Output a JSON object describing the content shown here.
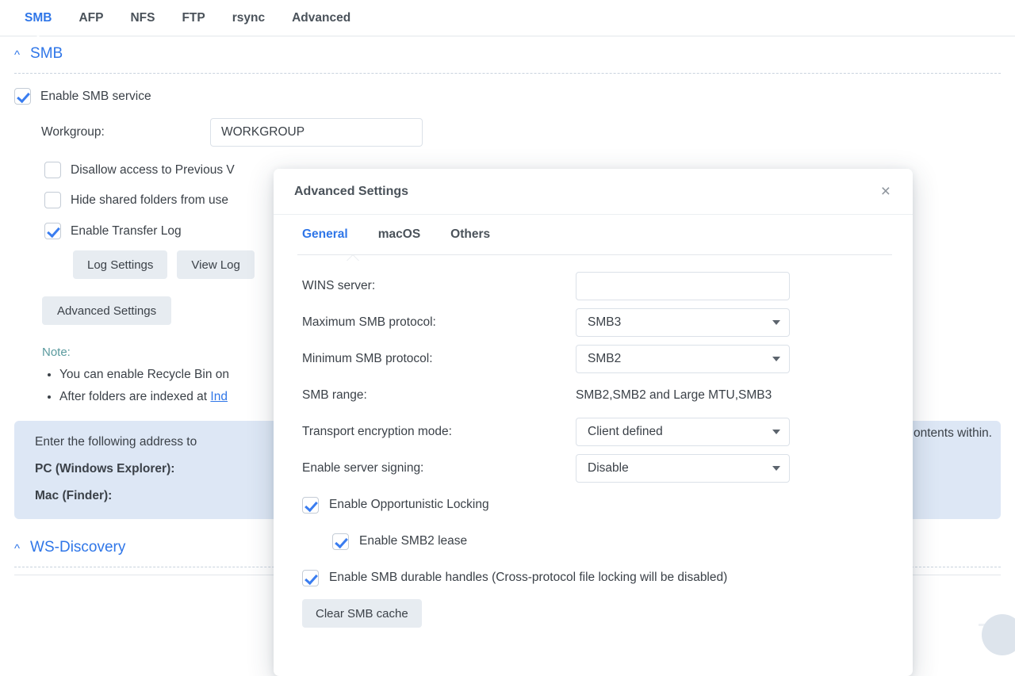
{
  "tabbar": {
    "tabs": [
      {
        "label": "SMB",
        "active": true
      },
      {
        "label": "AFP",
        "active": false
      },
      {
        "label": "NFS",
        "active": false
      },
      {
        "label": "FTP",
        "active": false
      },
      {
        "label": "rsync",
        "active": false
      },
      {
        "label": "Advanced",
        "active": false
      }
    ]
  },
  "smb_section": {
    "title": "SMB",
    "caret": "^",
    "enable_service": {
      "label": "Enable SMB service",
      "checked": true
    },
    "workgroup": {
      "label": "Workgroup:",
      "value": "WORKGROUP"
    },
    "disallow_previous": {
      "label": "Disallow access to Previous V",
      "checked": false
    },
    "hide_shared": {
      "label": "Hide shared folders from use",
      "checked": false
    },
    "transfer_log": {
      "label": "Enable Transfer Log",
      "checked": true
    },
    "log_settings_button": "Log Settings",
    "view_log_button": "View Log",
    "advanced_settings_button": "Advanced Settings",
    "note_title": "Note:",
    "note_items": [
      "You can enable Recycle Bin on",
      "After folders are indexed at Ind"
    ],
    "note_link": "Ind",
    "note_tail_right": "ontents within.",
    "infobox": {
      "line1": "Enter the following address to",
      "pc_label": "PC (Windows Explorer):",
      "mac_label": "Mac (Finder):"
    }
  },
  "wsdiscovery_section": {
    "title": "WS-Discovery",
    "caret": "^"
  },
  "dialog": {
    "title": "Advanced Settings",
    "close_icon": "×",
    "tabs": [
      {
        "label": "General",
        "active": true
      },
      {
        "label": "macOS",
        "active": false
      },
      {
        "label": "Others",
        "active": false
      }
    ],
    "fields": {
      "wins_server": {
        "label": "WINS server:",
        "value": "",
        "placeholder": ""
      },
      "max_protocol": {
        "label": "Maximum SMB protocol:",
        "value": "SMB3"
      },
      "min_protocol": {
        "label": "Minimum SMB protocol:",
        "value": "SMB2"
      },
      "smb_range": {
        "label": "SMB range:",
        "value": "SMB2,SMB2 and Large MTU,SMB3"
      },
      "transport_encryption": {
        "label": "Transport encryption mode:",
        "value": "Client defined"
      },
      "server_signing": {
        "label": "Enable server signing:",
        "value": "Disable"
      }
    },
    "checkboxes": {
      "oplock": {
        "label": "Enable Opportunistic Locking",
        "checked": true
      },
      "smb2_lease": {
        "label": "Enable SMB2 lease",
        "checked": true
      },
      "durable_handles": {
        "label": "Enable SMB durable handles (Cross-protocol file locking will be disabled)",
        "checked": true
      }
    },
    "clear_cache_button": "Clear SMB cache"
  },
  "colors": {
    "accent": "#2f76e8",
    "checkbox": "#3a7df0",
    "note": "#5a9a9e",
    "infobox_bg": "#dde7f5",
    "button_bg": "#e7ecf1"
  }
}
